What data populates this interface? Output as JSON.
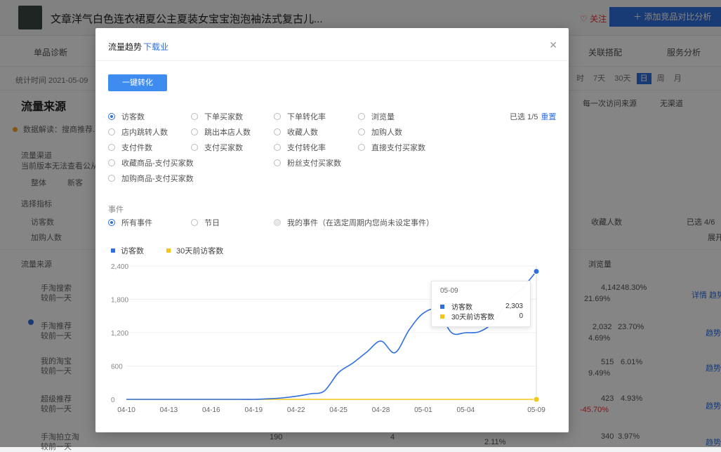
{
  "background": {
    "product_title": "文章洋气白色连衣裙夏公主夏装女宝宝泡泡袖法式复古儿...",
    "favorite_label": "♡ 关注",
    "compare_label": "＋ 添加竞品对比分析",
    "tabs": [
      "单品诊断",
      "关联搭配",
      "服务分析"
    ],
    "stat_time": "统计时间 2021-05-09",
    "period_options": [
      "时",
      "7天",
      "30天",
      "日",
      "周",
      "月"
    ],
    "active_period": "日",
    "section_title": "流量来源",
    "data_tip": "数据解读：搜商推荐...",
    "flow_label": "流量渠道",
    "flow_sub": "当前版本无法查看公从...",
    "whole_label": "整体",
    "new_label": "新客",
    "select_metric_label": "选择指标",
    "visitors_label": "访客数",
    "add_cart_label": "加购人数",
    "source_col": "流量来源",
    "first_visit_src": "每一次访问来源",
    "no_channel": "无渠道",
    "collect_col": "收藏人数",
    "selected_right": "已选 4/6",
    "expand_label": "展开",
    "browse_col": "浏览量",
    "rows": [
      {
        "name": "手淘搜索",
        "sub": "较前一天",
        "v1": "4,142",
        "v2": "48.30%",
        "v3": "21.69%",
        "action": "详情 趋势"
      },
      {
        "name": "手淘推荐",
        "sub": "较前一天",
        "v1": "2,032",
        "v2": "23.70%",
        "v3": "4.69%",
        "action": "趋势"
      },
      {
        "name": "我的淘宝",
        "sub": "较前一天",
        "v1": "515",
        "v2": "6.01%",
        "v3": "9.49%",
        "action": "趋势"
      },
      {
        "name": "超级推荐",
        "sub": "较前一天",
        "v1": "423",
        "v2": "4.93%",
        "v3": "-45.70%",
        "action": "趋势"
      },
      {
        "name": "手淘拍立淘",
        "sub": "较前一天",
        "v1": "340",
        "v2": "3.97%",
        "v3": "",
        "action": "趋势"
      }
    ],
    "bottom_vals": [
      "190",
      "4",
      "2.11%"
    ]
  },
  "modal": {
    "title": "流量趋势",
    "subtitle": "下载业",
    "close_icon": "close-icon",
    "optimize_button": "一键转化",
    "selected_info": "已选 1/5",
    "reset_label": "重置",
    "metrics": [
      {
        "label": "访客数",
        "checked": true
      },
      {
        "label": "下单买家数",
        "checked": false
      },
      {
        "label": "下单转化率",
        "checked": false
      },
      {
        "label": "浏览量",
        "checked": false
      },
      {
        "label": "店内跳转人数",
        "checked": false
      },
      {
        "label": "跳出本店人数",
        "checked": false
      },
      {
        "label": "收藏人数",
        "checked": false
      },
      {
        "label": "加购人数",
        "checked": false
      },
      {
        "label": "支付件数",
        "checked": false
      },
      {
        "label": "支付买家数",
        "checked": false
      },
      {
        "label": "支付转化率",
        "checked": false
      },
      {
        "label": "直接支付买家数",
        "checked": false
      },
      {
        "label": "收藏商品-支付买家数",
        "checked": false
      },
      {
        "label": "粉丝支付买家数",
        "checked": false
      },
      {
        "label": "加购商品-支付买家数",
        "checked": false
      }
    ],
    "event_label": "事件",
    "events": [
      {
        "label": "所有事件",
        "checked": true,
        "disabled": false
      },
      {
        "label": "节日",
        "checked": false,
        "disabled": false
      },
      {
        "label": "我的事件（在选定周期内您尚未设定事件）",
        "checked": false,
        "disabled": true
      }
    ],
    "tooltip": {
      "date": "05-09",
      "rows": [
        {
          "name": "访客数",
          "value": "2,303",
          "color": "#2f6fe0"
        },
        {
          "name": "30天前访客数",
          "value": "0",
          "color": "#f5c518"
        }
      ]
    }
  },
  "chart_data": {
    "type": "line",
    "x": [
      "04-10",
      "04-11",
      "04-12",
      "04-13",
      "04-14",
      "04-15",
      "04-16",
      "04-17",
      "04-18",
      "04-19",
      "04-20",
      "04-21",
      "04-22",
      "04-23",
      "04-24",
      "04-25",
      "04-26",
      "04-27",
      "04-28",
      "04-29",
      "04-30",
      "05-01",
      "05-02",
      "05-03",
      "05-04",
      "05-05",
      "05-06",
      "05-07",
      "05-08",
      "05-09"
    ],
    "xticks": [
      "04-10",
      "04-13",
      "04-16",
      "04-19",
      "04-22",
      "04-25",
      "04-28",
      "05-01",
      "05-04",
      "05-09"
    ],
    "yticks": [
      0,
      600,
      1200,
      1800,
      2400
    ],
    "ylim": [
      0,
      2400
    ],
    "series": [
      {
        "name": "访客数",
        "color": "#2f6fe0",
        "values": [
          0,
          0,
          0,
          0,
          0,
          0,
          0,
          0,
          0,
          0,
          10,
          25,
          55,
          100,
          150,
          480,
          650,
          850,
          1050,
          840,
          1250,
          1550,
          1600,
          1200,
          1200,
          1220,
          1400,
          1780,
          2000,
          2303
        ]
      },
      {
        "name": "30天前访客数",
        "color": "#f5c518",
        "values": [
          0,
          0,
          0,
          0,
          0,
          0,
          0,
          0,
          0,
          0,
          0,
          0,
          0,
          0,
          0,
          0,
          0,
          0,
          0,
          0,
          0,
          0,
          0,
          0,
          0,
          0,
          0,
          0,
          0,
          0
        ]
      }
    ]
  }
}
